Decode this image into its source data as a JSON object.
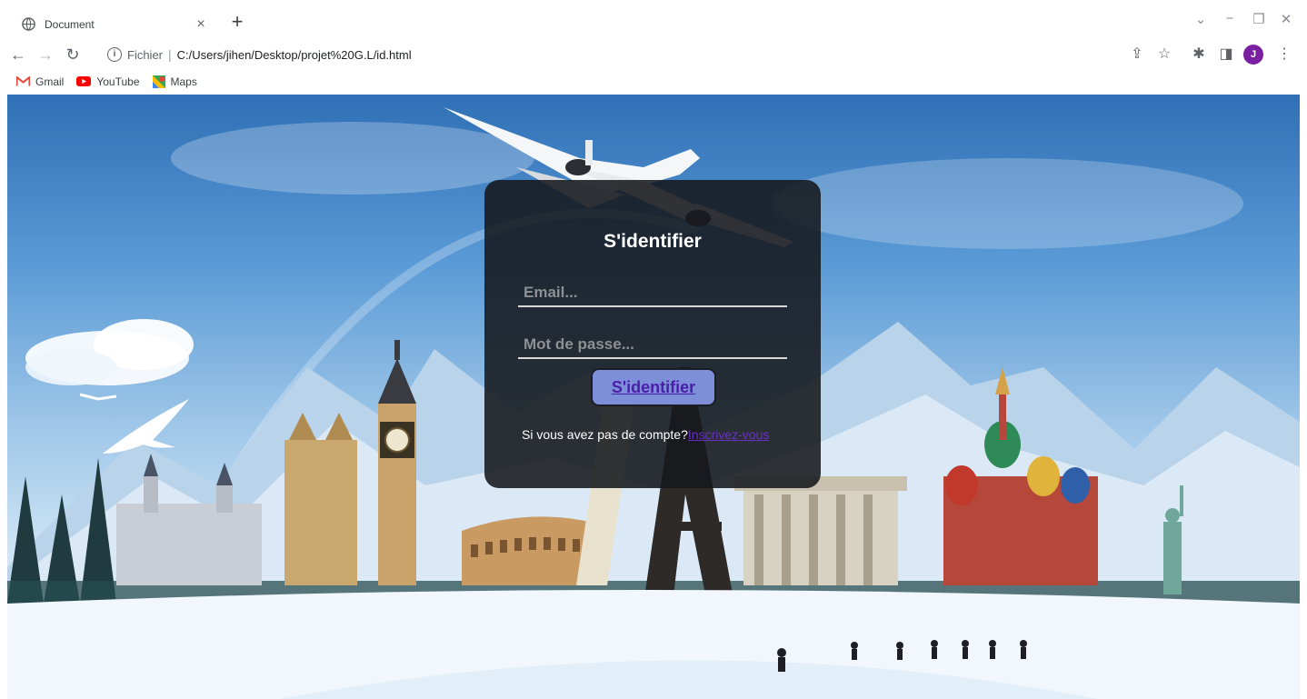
{
  "browser": {
    "tab_title": "Document",
    "address_scheme": "Fichier",
    "address_url": "C:/Users/jihen/Desktop/projet%20G.L/id.html",
    "profile_initial": "J",
    "bookmarks": [
      {
        "label": "Gmail",
        "icon": "gmail-icon"
      },
      {
        "label": "YouTube",
        "icon": "youtube-icon"
      },
      {
        "label": "Maps",
        "icon": "maps-icon"
      }
    ]
  },
  "login": {
    "title": "S'identifier",
    "email_placeholder": "Email...",
    "password_placeholder": "Mot de passe...",
    "submit_label": "S'identifier",
    "signup_prompt": "Si vous avez pas de compte?",
    "signup_link": "Inscrivez-vous"
  },
  "colors": {
    "card_bg": "#16181c",
    "button_bg": "#7d8fd9",
    "button_text": "#4a1fa8",
    "link": "#6a2fc4",
    "avatar": "#7b1fa2"
  }
}
